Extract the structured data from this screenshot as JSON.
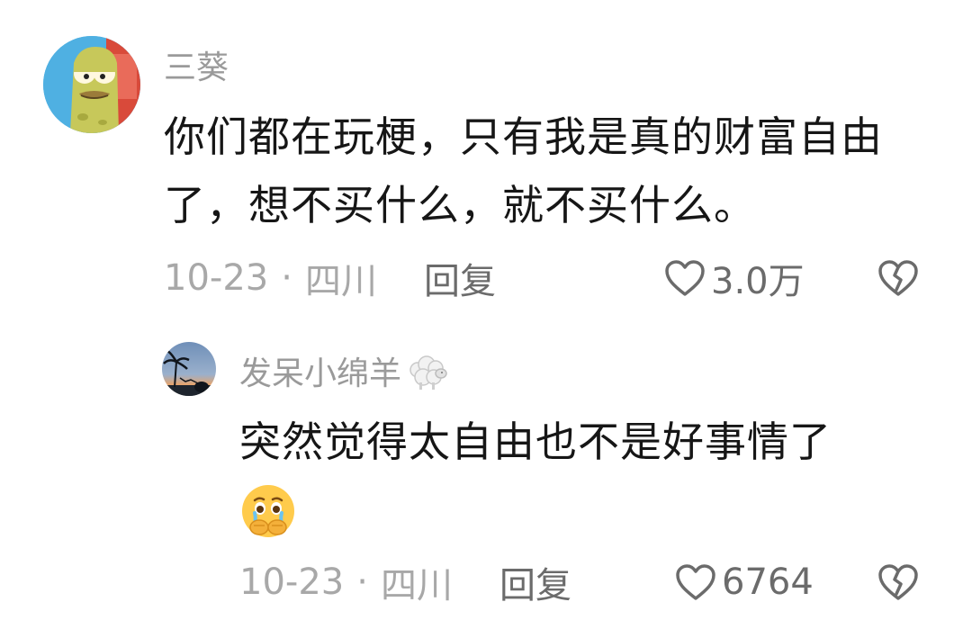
{
  "comments": [
    {
      "username": "三葵",
      "text": "你们都在玩梗，只有我是真的财富自由了，想不买什么，就不买什么。",
      "date": "10-23",
      "separator": "·",
      "location": "四川",
      "reply_label": "回复",
      "like_count": "3.0万",
      "avatar_icon": "cartoon-fish-avatar",
      "like_icon": "heart-outline-icon",
      "dislike_icon": "broken-heart-icon"
    },
    {
      "username": "发呆小绵羊",
      "username_badge_icon": "sheep-icon",
      "text": "突然觉得太自由也不是好事情了",
      "emoji_icon": "holding-back-tears-emoji",
      "date": "10-23",
      "separator": "·",
      "location": "四川",
      "reply_label": "回复",
      "like_count": "6764",
      "avatar_icon": "sunset-palm-avatar",
      "like_icon": "heart-outline-icon",
      "dislike_icon": "broken-heart-icon"
    }
  ],
  "colors": {
    "username": "#9a9a9a",
    "text": "#161616",
    "meta": "#a8a8a8",
    "action": "#6b6b6b"
  }
}
